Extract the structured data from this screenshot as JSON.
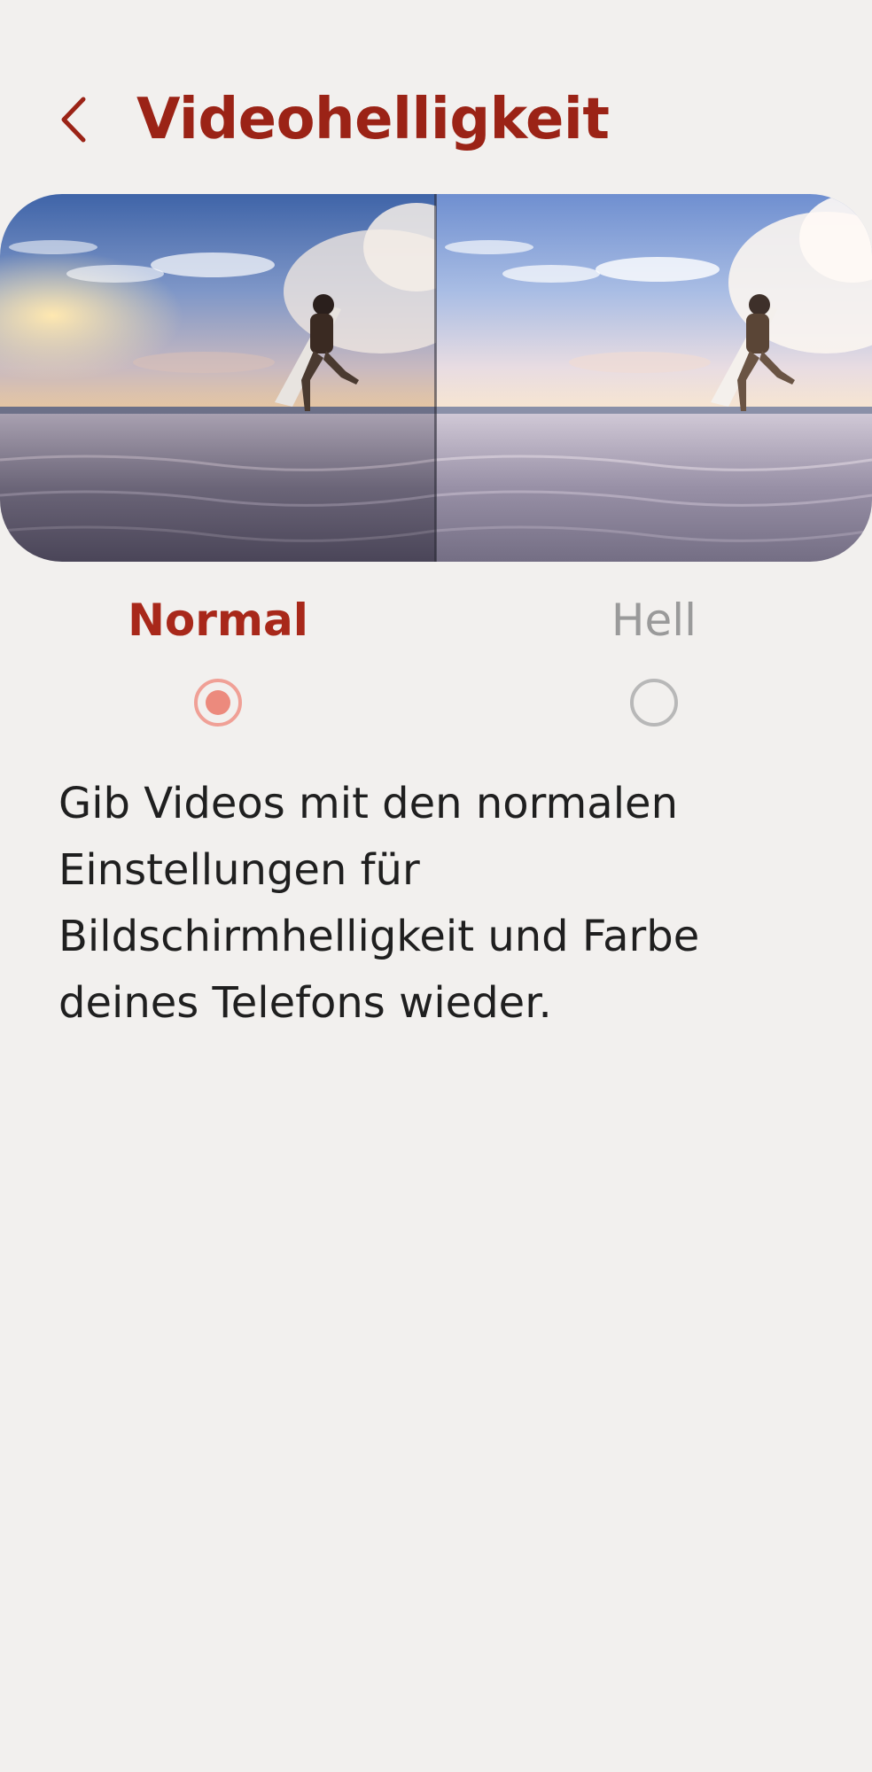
{
  "header": {
    "title": "Videohelligkeit"
  },
  "options": {
    "normal": {
      "label": "Normal",
      "selected": true
    },
    "bright": {
      "label": "Hell",
      "selected": false
    }
  },
  "description": "Gib Videos mit den normalen Einstellungen für Bildschirmhelligkeit und Farbe deines Telefons wieder.",
  "colors": {
    "accent": "#9b2316",
    "radio_selected": "#ec8a7d",
    "background": "#f2f0ee"
  }
}
